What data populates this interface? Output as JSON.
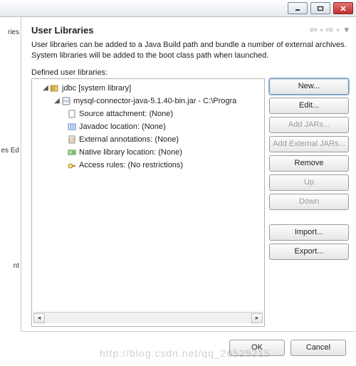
{
  "titlebar": {
    "minimize": "minimize",
    "maximize": "maximize",
    "close": "close"
  },
  "leftcol": {
    "frag1": "ries",
    "frag2": "es Ed",
    "frag3": "nt"
  },
  "header": {
    "title": "User Libraries"
  },
  "description": "User libraries can be added to a Java Build path and bundle a number of external archives. System libraries will be added to the boot class path when launched.",
  "defined_label": "Defined user libraries:",
  "tree": {
    "root": {
      "label": "jdbc [system library]",
      "jar": {
        "label": "mysql-connector-java-5.1.40-bin.jar - C:\\Progra",
        "props": [
          {
            "name": "source-attachment",
            "label": "Source attachment: (None)"
          },
          {
            "name": "javadoc-location",
            "label": "Javadoc location: (None)"
          },
          {
            "name": "external-annotations",
            "label": "External annotations: (None)"
          },
          {
            "name": "native-library-location",
            "label": "Native library location: (None)"
          },
          {
            "name": "access-rules",
            "label": "Access rules: (No restrictions)"
          }
        ]
      }
    }
  },
  "buttons": {
    "new": "New...",
    "edit": "Edit...",
    "add_jars": "Add JARs...",
    "add_external_jars": "Add External JARs...",
    "remove": "Remove",
    "up": "Up",
    "down": "Down",
    "import": "Import...",
    "export": "Export..."
  },
  "footer": {
    "ok": "OK",
    "cancel": "Cancel"
  },
  "watermark": "http://blog.csdn.net/qq_26525215"
}
